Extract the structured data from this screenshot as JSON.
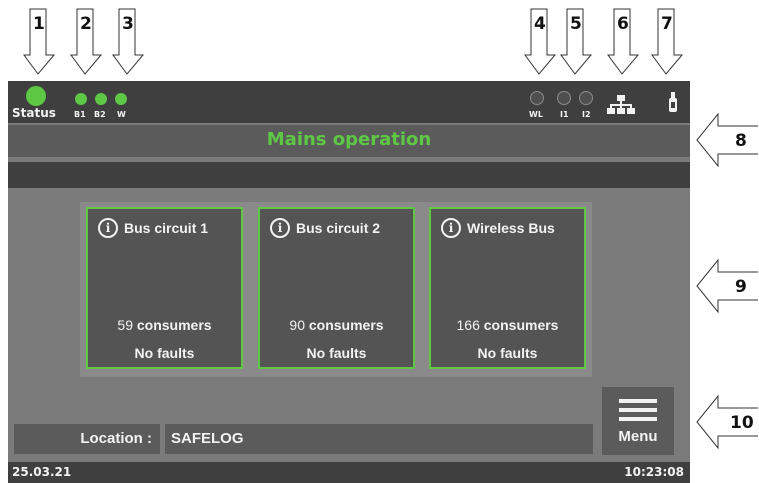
{
  "callouts_top": [
    "1",
    "2",
    "3",
    "4",
    "5",
    "6",
    "7"
  ],
  "callouts_right": [
    "8",
    "9",
    "10"
  ],
  "status": {
    "label": "Status",
    "bus_labels": [
      "B1",
      "B2",
      "W"
    ],
    "input_labels": [
      "WL",
      "I1",
      "I2"
    ],
    "active_color": "#5ec845",
    "icons": [
      "network-icon",
      "usb-icon"
    ]
  },
  "title": "Mains operation",
  "cards": [
    {
      "title": "Bus circuit 1",
      "count": "59",
      "unit": "consumers",
      "faults": "No faults"
    },
    {
      "title": "Bus circuit 2",
      "count": "90",
      "unit": "consumers",
      "faults": "No faults"
    },
    {
      "title": "Wireless Bus",
      "count": "166",
      "unit": "consumers",
      "faults": "No faults"
    }
  ],
  "location": {
    "label": "Location :",
    "value": "SAFELOG"
  },
  "menu": {
    "label": "Menu"
  },
  "footer": {
    "date": "25.03.21",
    "time": "10:23:08"
  }
}
